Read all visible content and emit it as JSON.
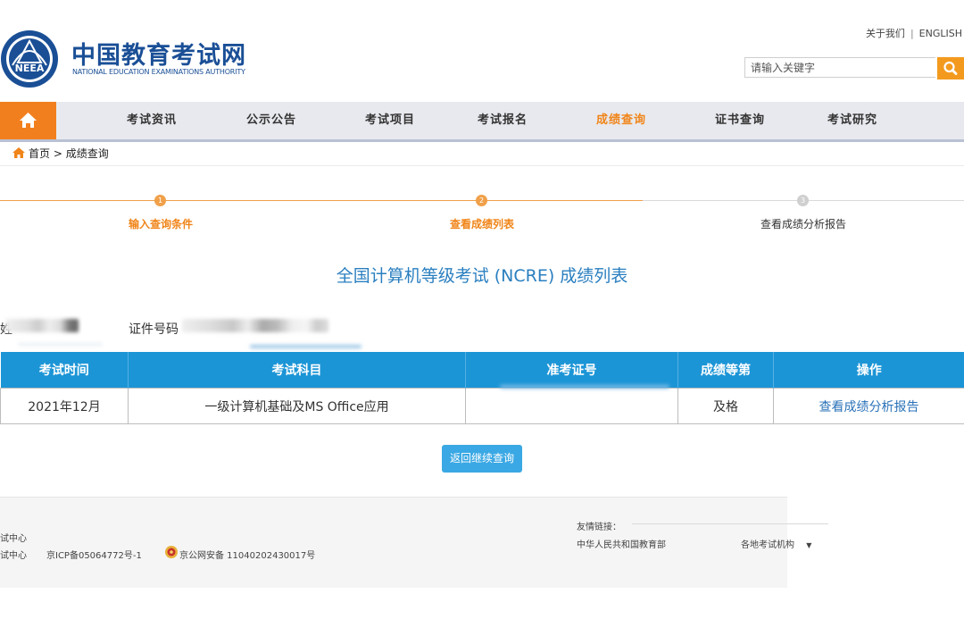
{
  "header": {
    "logo_cn": "中国教育考试网",
    "logo_en": "NATIONAL EDUCATION EXAMINATIONS AUTHORITY",
    "logo_emblem_text": "NEEA",
    "top_links": [
      "关于我们",
      "ENGLISH"
    ],
    "top_link_separator": "|",
    "search_placeholder": "请输入关键字",
    "search_icon": "search-icon"
  },
  "nav": {
    "home_icon": "home-icon",
    "items": [
      {
        "label": "考试资讯"
      },
      {
        "label": "公示公告"
      },
      {
        "label": "考试项目"
      },
      {
        "label": "考试报名"
      },
      {
        "label": "成绩查询",
        "active": true
      },
      {
        "label": "证书查询"
      },
      {
        "label": "考试研究"
      }
    ],
    "accent_color": "#f08519"
  },
  "breadcrumb": {
    "home": "首页",
    "separator": ">",
    "current": "成绩查询"
  },
  "steps": [
    {
      "number": "1",
      "label": "输入查询条件",
      "state": "done"
    },
    {
      "number": "2",
      "label": "查看成绩列表",
      "state": "current"
    },
    {
      "number": "3",
      "label": "查看成绩分析报告",
      "state": "pending"
    }
  ],
  "page_title": "全国计算机等级考试 (NCRE) 成绩列表",
  "info": {
    "name_label_fragment": "姓",
    "id_label": "证件号码"
  },
  "table": {
    "headers": [
      "考试时间",
      "考试科目",
      "准考证号",
      "成绩等第",
      "操作"
    ],
    "rows": [
      {
        "time": "2021年12月",
        "subject": "一级计算机基础及MS Office应用",
        "ticket": "",
        "grade": "及格",
        "action": "查看成绩分析报告"
      }
    ],
    "header_color": "#1c95d6"
  },
  "back_button": "返回继续查询",
  "footer": {
    "org_line1": "试中心",
    "org_line2": "试中心",
    "icp": "京ICP备05064772号-1",
    "police": "京公网安备 11040202430017号",
    "friend_links_label": "友情链接：",
    "friend_link_ministry": "中华人民共和国教育部",
    "local_agencies": "各地考试机构",
    "dropdown_arrow": "▼"
  }
}
